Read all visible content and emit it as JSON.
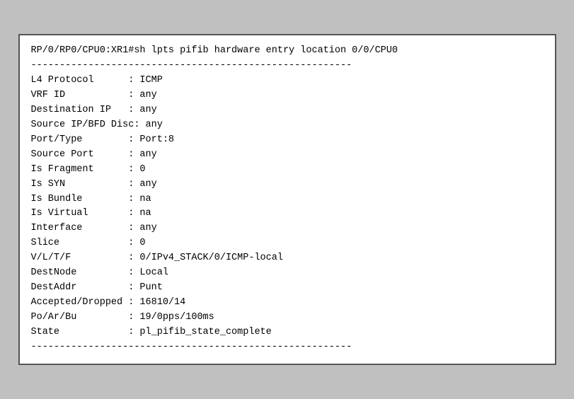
{
  "terminal": {
    "command_line": "RP/0/RP0/CPU0:XR1#sh lpts pifib hardware entry location 0/0/CPU0",
    "divider": "--------------------------------------------------------",
    "fields": [
      {
        "name": "L4 Protocol",
        "sep": " : ",
        "value": "ICMP"
      },
      {
        "name": "VRF ID",
        "sep": "        : ",
        "value": "any"
      },
      {
        "name": "Destination IP",
        "sep": "  : ",
        "value": "any"
      },
      {
        "name": "Source IP/BFD Disc",
        "sep": ": ",
        "value": "any"
      },
      {
        "name": "Port/Type",
        "sep": "       : ",
        "value": "Port:8"
      },
      {
        "name": "Source Port",
        "sep": "     : ",
        "value": "any"
      },
      {
        "name": "Is Fragment",
        "sep": "    : ",
        "value": "0"
      },
      {
        "name": "Is SYN",
        "sep": "         : ",
        "value": "any"
      },
      {
        "name": "Is Bundle",
        "sep": "      : ",
        "value": "na"
      },
      {
        "name": "Is Virtual",
        "sep": "     : ",
        "value": "na"
      },
      {
        "name": "Interface",
        "sep": "       : ",
        "value": "any"
      },
      {
        "name": "Slice",
        "sep": "           : ",
        "value": "0"
      },
      {
        "name": "V/L/T/F",
        "sep": "         : ",
        "value": "0/IPv4_STACK/0/ICMP-local"
      },
      {
        "name": "DestNode",
        "sep": "        : ",
        "value": "Local"
      },
      {
        "name": "DestAddr",
        "sep": "        : ",
        "value": "Punt"
      },
      {
        "name": "Accepted/Dropped",
        "sep": " : ",
        "value": "16810/14"
      },
      {
        "name": "Po/Ar/Bu",
        "sep": "        : ",
        "value": "19/0pps/100ms"
      },
      {
        "name": "State",
        "sep": "           : ",
        "value": "pl_pifib_state_complete"
      }
    ],
    "divider_bottom": "--------------------------------------------------------"
  }
}
